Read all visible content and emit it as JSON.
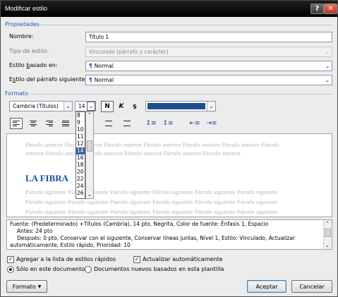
{
  "window": {
    "title": "Modificar estilo"
  },
  "properties": {
    "section_label": "Propiedades",
    "name_label": "Nombre:",
    "name_value": "Título 1",
    "style_type_label": "Tipo de estilo:",
    "style_type_value": "Vinculado (párrafo y carácter)",
    "based_on_label": "Estilo basado en:",
    "based_on_value": "Normal",
    "next_para_label": "Estilo del párrafo siguiente:",
    "next_para_value": "Normal"
  },
  "format": {
    "section_label": "Formato",
    "font": "Cambria (Títulos)",
    "size": "14",
    "bold": "N",
    "italic": "K",
    "underline": "S",
    "font_color": "#1f4e8c",
    "size_options": [
      "8",
      "9",
      "10",
      "11",
      "12",
      "14",
      "16",
      "18",
      "20",
      "22",
      "24",
      "26"
    ],
    "selected_size": "14"
  },
  "preview": {
    "previous_line_1": "Párrafo anterior Párrafo anterior Párrafo anterior Párrafo anterior Párrafo anterior Párrafo anterior Párrafo",
    "previous_line_2": "anterior Párrafo anterior Párrafo anterior Párrafo anterior Párrafo anterior Párrafo anterior",
    "heading": "LA FIBRA",
    "next_line_1": "Párrafo siguiente Párrafo siguiente Párrafo siguiente Párrafo siguiente Párrafo siguiente Párrafo siguiente",
    "next_line_2": "Párrafo siguiente Párrafo siguiente Párrafo siguiente Párrafo siguiente Párrafo siguiente Párrafo siguiente",
    "next_line_3": "Párrafo siguiente Párrafo siguiente Párrafo siguiente Párrafo siguiente Párrafo siguiente Párrafo siguiente"
  },
  "description": {
    "line1": "Fuente: (Predeterminado) +Títulos (Cambria), 14 pto, Negrita, Color de fuente: Énfasis 1, Espacio",
    "line2": "Antes:  24 pto",
    "line3": "Después:  0 pto, Conservar con el siguiente, Conservar líneas juntas, Nivel 1, Estilo: Vinculado, Actualizar",
    "line4": "automáticamente, Estilo rápido, Prioridad: 10"
  },
  "options": {
    "add_quick_styles": "Agregar a la lista de estilos rápidos",
    "auto_update": "Actualizar automáticamente",
    "only_this_doc": "Sólo en este documento",
    "new_docs_template": "Documentos nuevos basados en esta plantilla"
  },
  "buttons": {
    "format": "Formato",
    "ok": "Aceptar",
    "cancel": "Cancelar"
  }
}
